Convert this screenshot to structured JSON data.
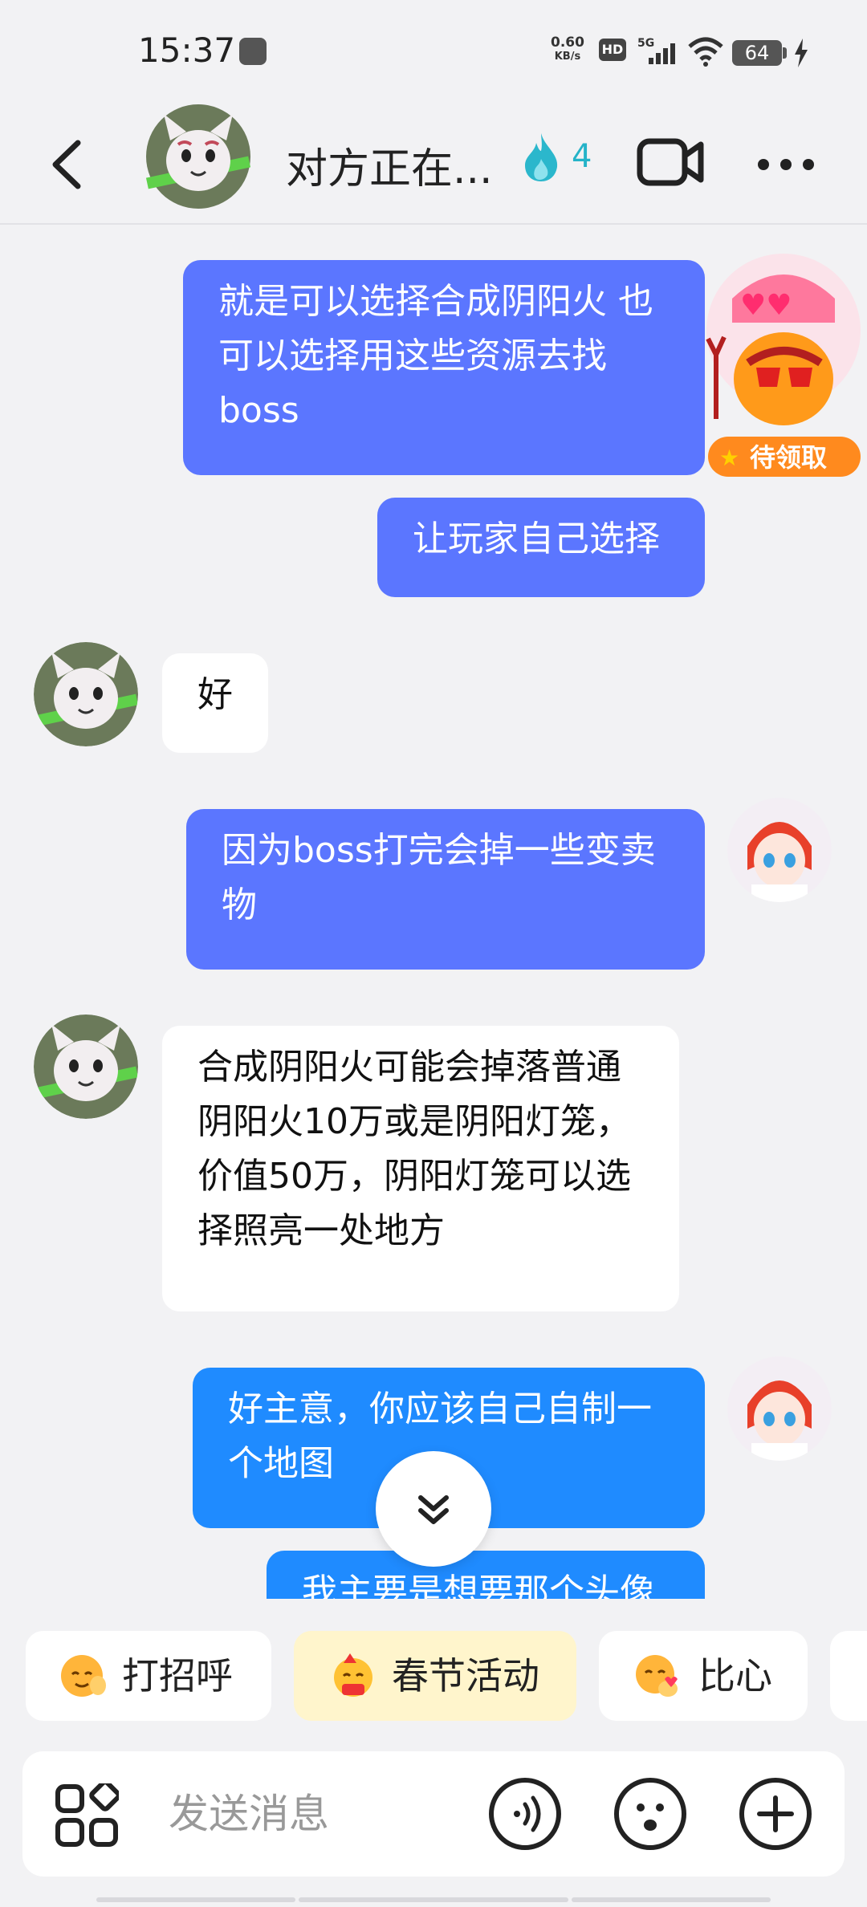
{
  "status_bar": {
    "time": "15:37",
    "net_speed_value": "0.60",
    "net_speed_unit": "KB/s",
    "hd": "HD",
    "network": "5G",
    "battery": "64"
  },
  "header": {
    "title": "对方正在...",
    "spark_count": "4"
  },
  "messages": [
    {
      "side": "out",
      "text": "就是可以选择合成阴阳火 也可以选择用这些资源去找boss"
    },
    {
      "side": "out",
      "text": "让玩家自己选择"
    },
    {
      "side": "in",
      "text": "好"
    },
    {
      "side": "out",
      "text": "因为boss打完会掉一些变卖物"
    },
    {
      "side": "in",
      "text": "合成阴阳火可能会掉落普通阴阳火10万或是阴阳灯笼，价值50万，阴阳灯笼可以选择照亮一处地方"
    },
    {
      "side": "out",
      "text": "好主意，你应该自己自制一个地图"
    },
    {
      "side": "out",
      "text": "我主要是想要那个头像"
    }
  ],
  "sticker_badge": "待领取",
  "quick_actions": [
    {
      "label": "打招呼"
    },
    {
      "label": "春节活动"
    },
    {
      "label": "比心"
    }
  ],
  "input": {
    "placeholder": "发送消息"
  },
  "colors": {
    "outgoing_bubble": "#5b76ff",
    "outgoing_bubble_latest": "#1f8bff",
    "incoming_bubble": "#ffffff",
    "background": "#f2f2f4",
    "spark": "#25b3c8"
  }
}
